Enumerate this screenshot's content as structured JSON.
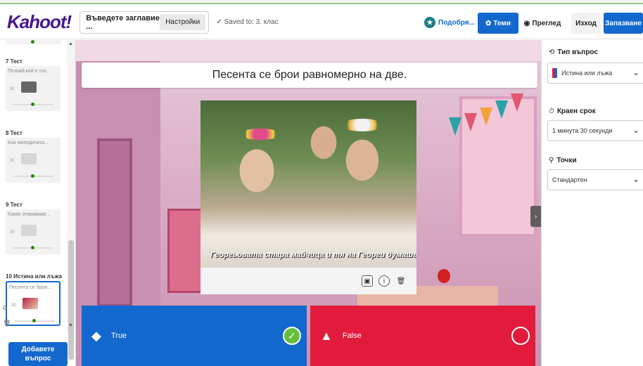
{
  "topbar": {
    "logo": "Kahoot!",
    "title_placeholder": "Въведете заглавие ...",
    "settings_label": "Настройки",
    "saved_text": "Saved to: 3. клас",
    "upgrade_label": "Подобря...",
    "themes_label": "Теми",
    "preview_label": "Преглед",
    "exit_label": "Изход",
    "save_label": "Запазване"
  },
  "sidebar": {
    "slides": [
      {
        "header": "7  Тест",
        "question": "Познай кой е тоз...",
        "time": "30"
      },
      {
        "header": "8  Тест",
        "question": "Кои мелодическ...",
        "time": "30"
      },
      {
        "header": "9  Тест",
        "question": "Какво откриваме...",
        "time": "30"
      },
      {
        "header": "10  Истина или лъжа",
        "question": "Песента се брои...",
        "time": "30"
      }
    ],
    "add_question_label": "Добавете въпрос"
  },
  "editor": {
    "question": "Песента се брои равномерно на две.",
    "media_caption": "Георгьовата стара майчица и тя на Георги думаше:",
    "answers": [
      {
        "label": "True",
        "shape": "diamond-icon",
        "correct": true,
        "color": "#1368ce"
      },
      {
        "label": "False",
        "shape": "triangle-icon",
        "correct": false,
        "color": "#e21b3c"
      }
    ]
  },
  "panel": {
    "question_type_label": "Тип въпрос",
    "question_type_value": "Истина или лъжа",
    "time_limit_label": "Краен срок",
    "time_limit_value": "1 минута 30 секунди",
    "points_label": "Точки",
    "points_value": "Стандартен"
  },
  "colors": {
    "brand": "#46178f",
    "primary_blue": "#1368ce",
    "answer_red": "#e21b3c",
    "correct_green": "#66bf39"
  }
}
